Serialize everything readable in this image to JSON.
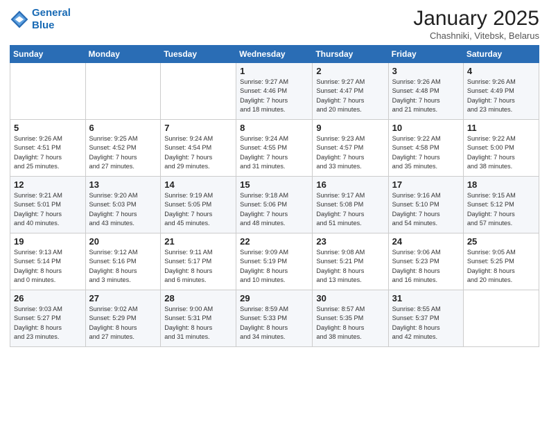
{
  "header": {
    "logo_line1": "General",
    "logo_line2": "Blue",
    "month": "January 2025",
    "location": "Chashniki, Vitebsk, Belarus"
  },
  "weekdays": [
    "Sunday",
    "Monday",
    "Tuesday",
    "Wednesday",
    "Thursday",
    "Friday",
    "Saturday"
  ],
  "weeks": [
    [
      {
        "day": "",
        "info": ""
      },
      {
        "day": "",
        "info": ""
      },
      {
        "day": "",
        "info": ""
      },
      {
        "day": "1",
        "info": "Sunrise: 9:27 AM\nSunset: 4:46 PM\nDaylight: 7 hours\nand 18 minutes."
      },
      {
        "day": "2",
        "info": "Sunrise: 9:27 AM\nSunset: 4:47 PM\nDaylight: 7 hours\nand 20 minutes."
      },
      {
        "day": "3",
        "info": "Sunrise: 9:26 AM\nSunset: 4:48 PM\nDaylight: 7 hours\nand 21 minutes."
      },
      {
        "day": "4",
        "info": "Sunrise: 9:26 AM\nSunset: 4:49 PM\nDaylight: 7 hours\nand 23 minutes."
      }
    ],
    [
      {
        "day": "5",
        "info": "Sunrise: 9:26 AM\nSunset: 4:51 PM\nDaylight: 7 hours\nand 25 minutes."
      },
      {
        "day": "6",
        "info": "Sunrise: 9:25 AM\nSunset: 4:52 PM\nDaylight: 7 hours\nand 27 minutes."
      },
      {
        "day": "7",
        "info": "Sunrise: 9:24 AM\nSunset: 4:54 PM\nDaylight: 7 hours\nand 29 minutes."
      },
      {
        "day": "8",
        "info": "Sunrise: 9:24 AM\nSunset: 4:55 PM\nDaylight: 7 hours\nand 31 minutes."
      },
      {
        "day": "9",
        "info": "Sunrise: 9:23 AM\nSunset: 4:57 PM\nDaylight: 7 hours\nand 33 minutes."
      },
      {
        "day": "10",
        "info": "Sunrise: 9:22 AM\nSunset: 4:58 PM\nDaylight: 7 hours\nand 35 minutes."
      },
      {
        "day": "11",
        "info": "Sunrise: 9:22 AM\nSunset: 5:00 PM\nDaylight: 7 hours\nand 38 minutes."
      }
    ],
    [
      {
        "day": "12",
        "info": "Sunrise: 9:21 AM\nSunset: 5:01 PM\nDaylight: 7 hours\nand 40 minutes."
      },
      {
        "day": "13",
        "info": "Sunrise: 9:20 AM\nSunset: 5:03 PM\nDaylight: 7 hours\nand 43 minutes."
      },
      {
        "day": "14",
        "info": "Sunrise: 9:19 AM\nSunset: 5:05 PM\nDaylight: 7 hours\nand 45 minutes."
      },
      {
        "day": "15",
        "info": "Sunrise: 9:18 AM\nSunset: 5:06 PM\nDaylight: 7 hours\nand 48 minutes."
      },
      {
        "day": "16",
        "info": "Sunrise: 9:17 AM\nSunset: 5:08 PM\nDaylight: 7 hours\nand 51 minutes."
      },
      {
        "day": "17",
        "info": "Sunrise: 9:16 AM\nSunset: 5:10 PM\nDaylight: 7 hours\nand 54 minutes."
      },
      {
        "day": "18",
        "info": "Sunrise: 9:15 AM\nSunset: 5:12 PM\nDaylight: 7 hours\nand 57 minutes."
      }
    ],
    [
      {
        "day": "19",
        "info": "Sunrise: 9:13 AM\nSunset: 5:14 PM\nDaylight: 8 hours\nand 0 minutes."
      },
      {
        "day": "20",
        "info": "Sunrise: 9:12 AM\nSunset: 5:16 PM\nDaylight: 8 hours\nand 3 minutes."
      },
      {
        "day": "21",
        "info": "Sunrise: 9:11 AM\nSunset: 5:17 PM\nDaylight: 8 hours\nand 6 minutes."
      },
      {
        "day": "22",
        "info": "Sunrise: 9:09 AM\nSunset: 5:19 PM\nDaylight: 8 hours\nand 10 minutes."
      },
      {
        "day": "23",
        "info": "Sunrise: 9:08 AM\nSunset: 5:21 PM\nDaylight: 8 hours\nand 13 minutes."
      },
      {
        "day": "24",
        "info": "Sunrise: 9:06 AM\nSunset: 5:23 PM\nDaylight: 8 hours\nand 16 minutes."
      },
      {
        "day": "25",
        "info": "Sunrise: 9:05 AM\nSunset: 5:25 PM\nDaylight: 8 hours\nand 20 minutes."
      }
    ],
    [
      {
        "day": "26",
        "info": "Sunrise: 9:03 AM\nSunset: 5:27 PM\nDaylight: 8 hours\nand 23 minutes."
      },
      {
        "day": "27",
        "info": "Sunrise: 9:02 AM\nSunset: 5:29 PM\nDaylight: 8 hours\nand 27 minutes."
      },
      {
        "day": "28",
        "info": "Sunrise: 9:00 AM\nSunset: 5:31 PM\nDaylight: 8 hours\nand 31 minutes."
      },
      {
        "day": "29",
        "info": "Sunrise: 8:59 AM\nSunset: 5:33 PM\nDaylight: 8 hours\nand 34 minutes."
      },
      {
        "day": "30",
        "info": "Sunrise: 8:57 AM\nSunset: 5:35 PM\nDaylight: 8 hours\nand 38 minutes."
      },
      {
        "day": "31",
        "info": "Sunrise: 8:55 AM\nSunset: 5:37 PM\nDaylight: 8 hours\nand 42 minutes."
      },
      {
        "day": "",
        "info": ""
      }
    ]
  ]
}
